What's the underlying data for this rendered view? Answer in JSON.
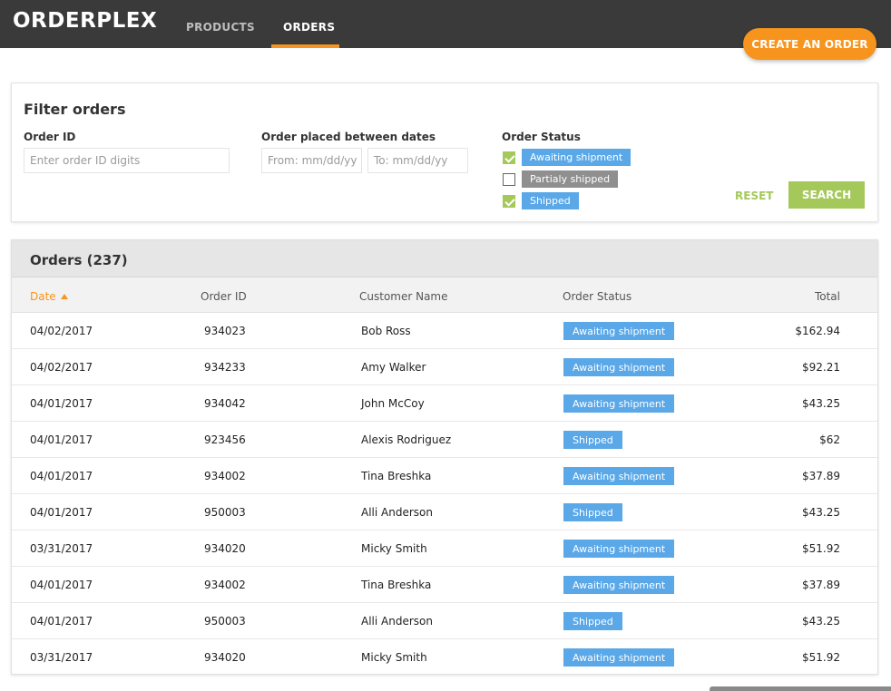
{
  "app": {
    "logo": "ORDERPLEX"
  },
  "nav": {
    "products": "PRODUCTS",
    "orders": "ORDERS",
    "create_order": "CREATE AN ORDER"
  },
  "filter": {
    "title": "Filter orders",
    "order_id_label": "Order ID",
    "order_id_placeholder": "Enter order ID digits",
    "dates_label": "Order placed between dates",
    "from_placeholder": "From: mm/dd/yy",
    "to_placeholder": "To: mm/dd/yy",
    "status_label": "Order Status",
    "statuses": [
      {
        "label": "Awaiting shipment",
        "checked": true
      },
      {
        "label": "Partialy shipped",
        "checked": false
      },
      {
        "label": "Shipped",
        "checked": true
      }
    ],
    "reset": "RESET",
    "search": "SEARCH"
  },
  "orders": {
    "title": "Orders (237)",
    "columns": {
      "date": "Date",
      "order_id": "Order ID",
      "customer": "Customer Name",
      "status": "Order Status",
      "total": "Total"
    },
    "rows": [
      {
        "date": "04/02/2017",
        "id": "934023",
        "name": "Bob Ross",
        "status": "Awaiting shipment",
        "total": "$162.94"
      },
      {
        "date": "04/02/2017",
        "id": "934233",
        "name": "Amy Walker",
        "status": "Awaiting shipment",
        "total": "$92.21"
      },
      {
        "date": "04/01/2017",
        "id": "934042",
        "name": "John McCoy",
        "status": "Awaiting shipment",
        "total": "$43.25"
      },
      {
        "date": "04/01/2017",
        "id": "923456",
        "name": "Alexis Rodriguez",
        "status": "Shipped",
        "total": "$62"
      },
      {
        "date": "04/01/2017",
        "id": "934002",
        "name": "Tina Breshka",
        "status": "Awaiting shipment",
        "total": "$37.89"
      },
      {
        "date": "04/01/2017",
        "id": "950003",
        "name": "Alli Anderson",
        "status": "Shipped",
        "total": "$43.25"
      },
      {
        "date": "03/31/2017",
        "id": "934020",
        "name": "Micky Smith",
        "status": "Awaiting shipment",
        "total": "$51.92"
      },
      {
        "date": "04/01/2017",
        "id": "934002",
        "name": "Tina Breshka",
        "status": "Awaiting shipment",
        "total": "$37.89"
      },
      {
        "date": "04/01/2017",
        "id": "950003",
        "name": "Alli Anderson",
        "status": "Shipped",
        "total": "$43.25"
      },
      {
        "date": "03/31/2017",
        "id": "934020",
        "name": "Micky Smith",
        "status": "Awaiting shipment",
        "total": "$51.92"
      }
    ]
  },
  "colors": {
    "accent": "#f7941d",
    "green": "#a5c85a",
    "status_blue": "#5aa8e8",
    "status_gray": "#8f8f8f",
    "topbar": "#3a3a3a"
  }
}
